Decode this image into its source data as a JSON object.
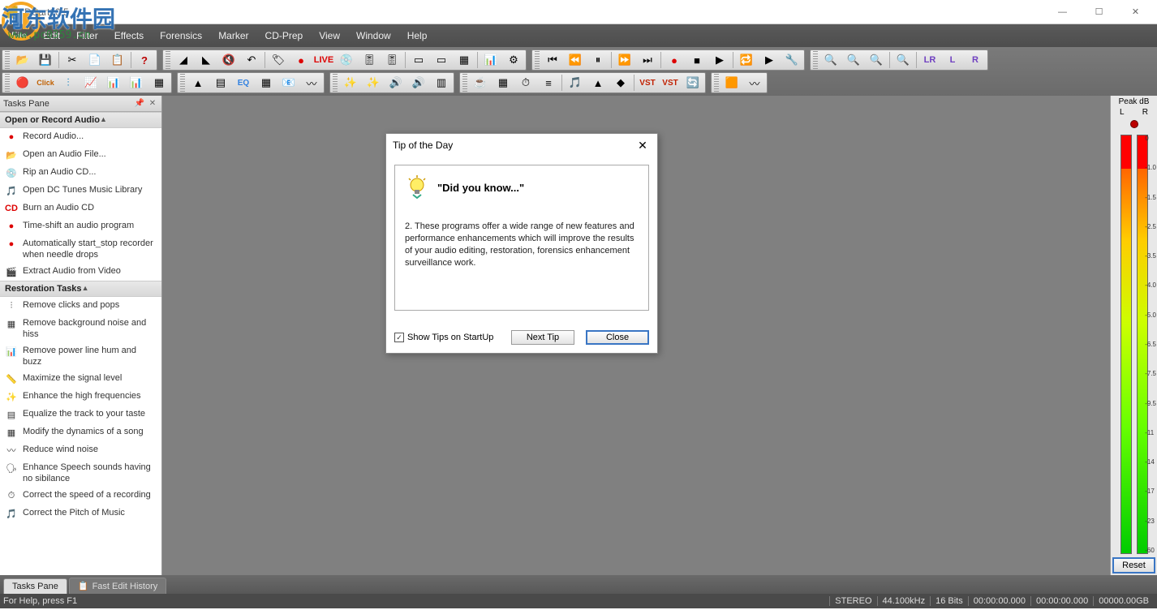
{
  "window": {
    "title": "DCart10.5"
  },
  "watermark": {
    "text": "河东软件园",
    "url": "www.pc0359.cn"
  },
  "windowControls": {
    "min": "—",
    "max": "☐",
    "close": "✕"
  },
  "menu": [
    "File",
    "Edit",
    "Filter",
    "Effects",
    "Forensics",
    "Marker",
    "CD-Prep",
    "View",
    "Window",
    "Help"
  ],
  "tasksPane": {
    "title": "Tasks Pane",
    "openSection": {
      "title": "Open or Record Audio",
      "items": [
        "Record Audio...",
        "Open an Audio File...",
        "Rip an Audio CD...",
        "Open DC Tunes Music Library",
        "Burn an Audio CD",
        "Time-shift an audio program",
        "Automatically start_stop recorder when needle drops",
        "Extract Audio from Video"
      ]
    },
    "restorationSection": {
      "title": "Restoration Tasks",
      "items": [
        "Remove clicks and pops",
        "Remove background noise and hiss",
        "Remove power line hum and buzz",
        "Maximize the signal level",
        "Enhance the high frequencies",
        "Equalize the track to your taste",
        "Modify the dynamics of a song",
        "Reduce wind noise",
        "Enhance Speech sounds having no sibilance",
        "Correct the speed of a recording",
        "Correct the Pitch of Music"
      ]
    }
  },
  "bottomTabs": {
    "tab1": "Tasks Pane",
    "tab2": "Fast Edit History"
  },
  "statusbar": {
    "help": "For Help, press F1",
    "mode": "STEREO",
    "rate": "44.100kHz",
    "bits": "16 Bits",
    "time1": "00:00:00.000",
    "time2": "00:00:00.000",
    "size": "00000.00GB"
  },
  "peak": {
    "title": "Peak dB",
    "L": "L",
    "R": "R",
    "reset": "Reset",
    "scale": [
      "0",
      "-1.0",
      "-1.5",
      "-2.5",
      "-3.5",
      "-4.0",
      "-5.0",
      "-6.5",
      "-7.5",
      "-9.5",
      "-11",
      "-14",
      "-17",
      "-23",
      "-60"
    ]
  },
  "dialog": {
    "title": "Tip of the Day",
    "heading": "\"Did you know...\"",
    "body": "2. These programs offer a wide range of new features and performance enhancements which will improve the results of your audio editing, restoration, forensics enhancement  surveillance work.",
    "check": "Show Tips on StartUp",
    "nextTip": "Next Tip",
    "close": "Close"
  },
  "toolbarRow2": {
    "vst": "VST",
    "vstPlus": "VST",
    "lr": "LR",
    "l": "L",
    "r": "R",
    "live": "LIVE",
    "click": "Click",
    "eq": "EQ"
  }
}
